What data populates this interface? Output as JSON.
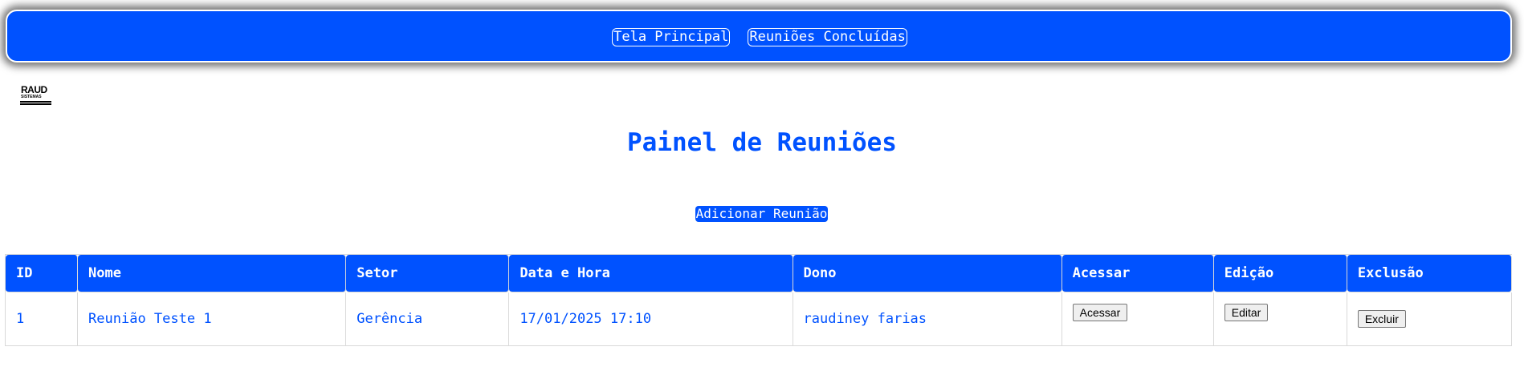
{
  "nav": {
    "links": [
      "Tela Principal",
      "Reuniões Concluídas"
    ]
  },
  "logo": {
    "line1": "RAUD",
    "line2": "SISTEMAS"
  },
  "page_title": "Painel de Reuniões",
  "add_button": "Adicionar Reunião",
  "table": {
    "headers": [
      "ID",
      "Nome",
      "Setor",
      "Data e Hora",
      "Dono",
      "Acessar",
      "Edição",
      "Exclusão"
    ],
    "rows": [
      {
        "id": "1",
        "nome": "Reunião Teste 1",
        "setor": "Gerência",
        "data_hora": "17/01/2025 17:10",
        "dono": "raudiney farias",
        "acessar": "Acessar",
        "editar": "Editar",
        "excluir": "Excluir"
      }
    ]
  },
  "colors": {
    "primary": "#0052ff",
    "text_on_primary": "#ffffff"
  }
}
